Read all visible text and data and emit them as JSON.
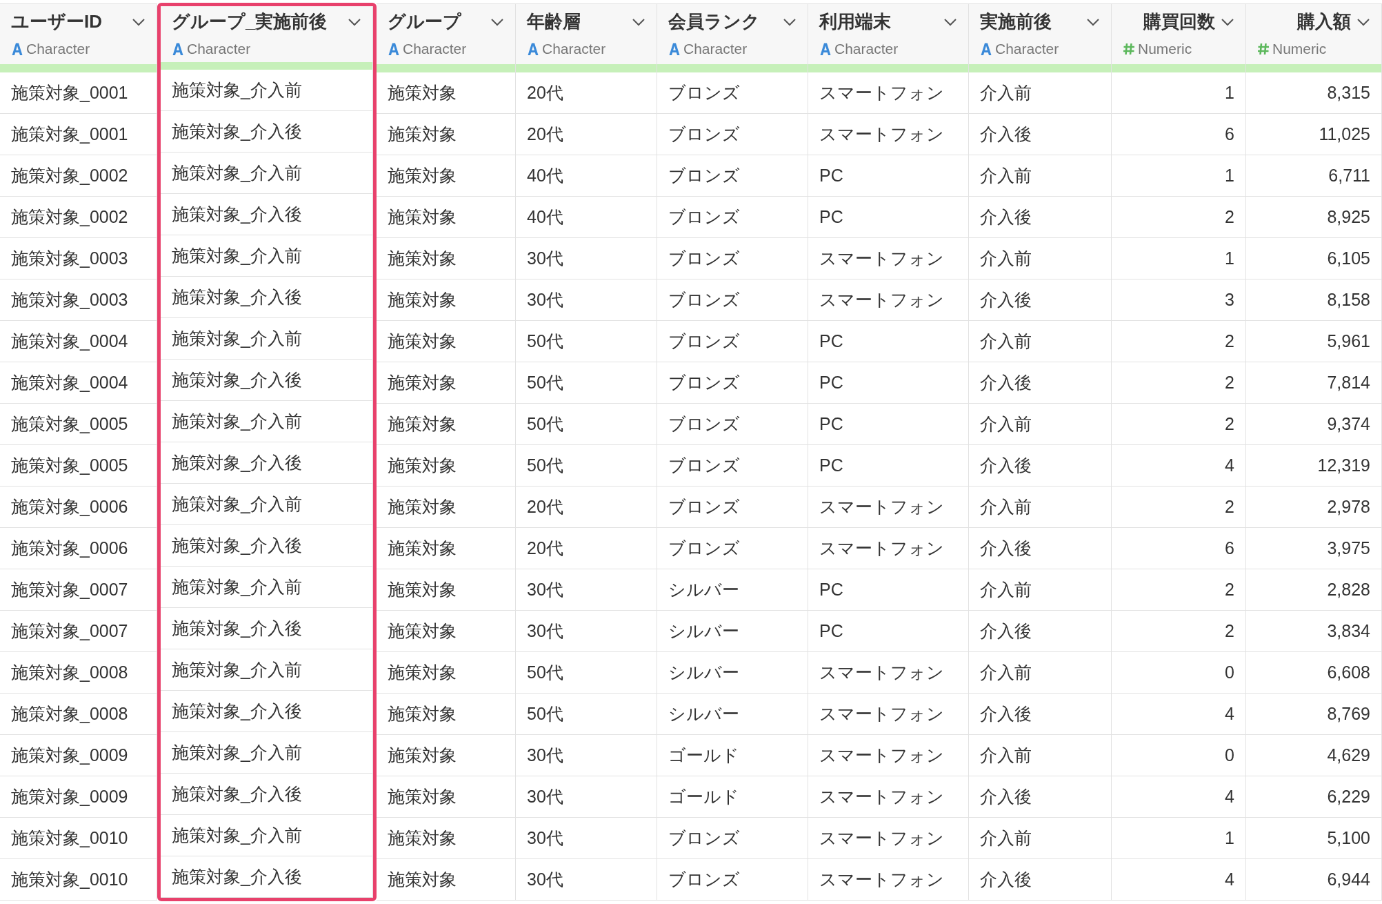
{
  "table": {
    "columns": [
      {
        "name": "ユーザーID",
        "type": "Character",
        "kind": "character",
        "highlighted": false
      },
      {
        "name": "グループ_実施前後",
        "type": "Character",
        "kind": "character",
        "highlighted": true
      },
      {
        "name": "グループ",
        "type": "Character",
        "kind": "character",
        "highlighted": false
      },
      {
        "name": "年齢層",
        "type": "Character",
        "kind": "character",
        "highlighted": false
      },
      {
        "name": "会員ランク",
        "type": "Character",
        "kind": "character",
        "highlighted": false
      },
      {
        "name": "利用端末",
        "type": "Character",
        "kind": "character",
        "highlighted": false
      },
      {
        "name": "実施前後",
        "type": "Character",
        "kind": "character",
        "highlighted": false
      },
      {
        "name": "購買回数",
        "type": "Numeric",
        "kind": "numeric",
        "highlighted": false
      },
      {
        "name": "購入額",
        "type": "Numeric",
        "kind": "numeric",
        "highlighted": false
      }
    ],
    "rows": [
      [
        "施策対象_0001",
        "施策対象_介入前",
        "施策対象",
        "20代",
        "ブロンズ",
        "スマートフォン",
        "介入前",
        "1",
        "8,315"
      ],
      [
        "施策対象_0001",
        "施策対象_介入後",
        "施策対象",
        "20代",
        "ブロンズ",
        "スマートフォン",
        "介入後",
        "6",
        "11,025"
      ],
      [
        "施策対象_0002",
        "施策対象_介入前",
        "施策対象",
        "40代",
        "ブロンズ",
        "PC",
        "介入前",
        "1",
        "6,711"
      ],
      [
        "施策対象_0002",
        "施策対象_介入後",
        "施策対象",
        "40代",
        "ブロンズ",
        "PC",
        "介入後",
        "2",
        "8,925"
      ],
      [
        "施策対象_0003",
        "施策対象_介入前",
        "施策対象",
        "30代",
        "ブロンズ",
        "スマートフォン",
        "介入前",
        "1",
        "6,105"
      ],
      [
        "施策対象_0003",
        "施策対象_介入後",
        "施策対象",
        "30代",
        "ブロンズ",
        "スマートフォン",
        "介入後",
        "3",
        "8,158"
      ],
      [
        "施策対象_0004",
        "施策対象_介入前",
        "施策対象",
        "50代",
        "ブロンズ",
        "PC",
        "介入前",
        "2",
        "5,961"
      ],
      [
        "施策対象_0004",
        "施策対象_介入後",
        "施策対象",
        "50代",
        "ブロンズ",
        "PC",
        "介入後",
        "2",
        "7,814"
      ],
      [
        "施策対象_0005",
        "施策対象_介入前",
        "施策対象",
        "50代",
        "ブロンズ",
        "PC",
        "介入前",
        "2",
        "9,374"
      ],
      [
        "施策対象_0005",
        "施策対象_介入後",
        "施策対象",
        "50代",
        "ブロンズ",
        "PC",
        "介入後",
        "4",
        "12,319"
      ],
      [
        "施策対象_0006",
        "施策対象_介入前",
        "施策対象",
        "20代",
        "ブロンズ",
        "スマートフォン",
        "介入前",
        "2",
        "2,978"
      ],
      [
        "施策対象_0006",
        "施策対象_介入後",
        "施策対象",
        "20代",
        "ブロンズ",
        "スマートフォン",
        "介入後",
        "6",
        "3,975"
      ],
      [
        "施策対象_0007",
        "施策対象_介入前",
        "施策対象",
        "30代",
        "シルバー",
        "PC",
        "介入前",
        "2",
        "2,828"
      ],
      [
        "施策対象_0007",
        "施策対象_介入後",
        "施策対象",
        "30代",
        "シルバー",
        "PC",
        "介入後",
        "2",
        "3,834"
      ],
      [
        "施策対象_0008",
        "施策対象_介入前",
        "施策対象",
        "50代",
        "シルバー",
        "スマートフォン",
        "介入前",
        "0",
        "6,608"
      ],
      [
        "施策対象_0008",
        "施策対象_介入後",
        "施策対象",
        "50代",
        "シルバー",
        "スマートフォン",
        "介入後",
        "4",
        "8,769"
      ],
      [
        "施策対象_0009",
        "施策対象_介入前",
        "施策対象",
        "30代",
        "ゴールド",
        "スマートフォン",
        "介入前",
        "0",
        "4,629"
      ],
      [
        "施策対象_0009",
        "施策対象_介入後",
        "施策対象",
        "30代",
        "ゴールド",
        "スマートフォン",
        "介入後",
        "4",
        "6,229"
      ],
      [
        "施策対象_0010",
        "施策対象_介入前",
        "施策対象",
        "30代",
        "ブロンズ",
        "スマートフォン",
        "介入前",
        "1",
        "5,100"
      ],
      [
        "施策対象_0010",
        "施策対象_介入後",
        "施策対象",
        "30代",
        "ブロンズ",
        "スマートフォン",
        "介入後",
        "4",
        "6,944"
      ]
    ]
  }
}
